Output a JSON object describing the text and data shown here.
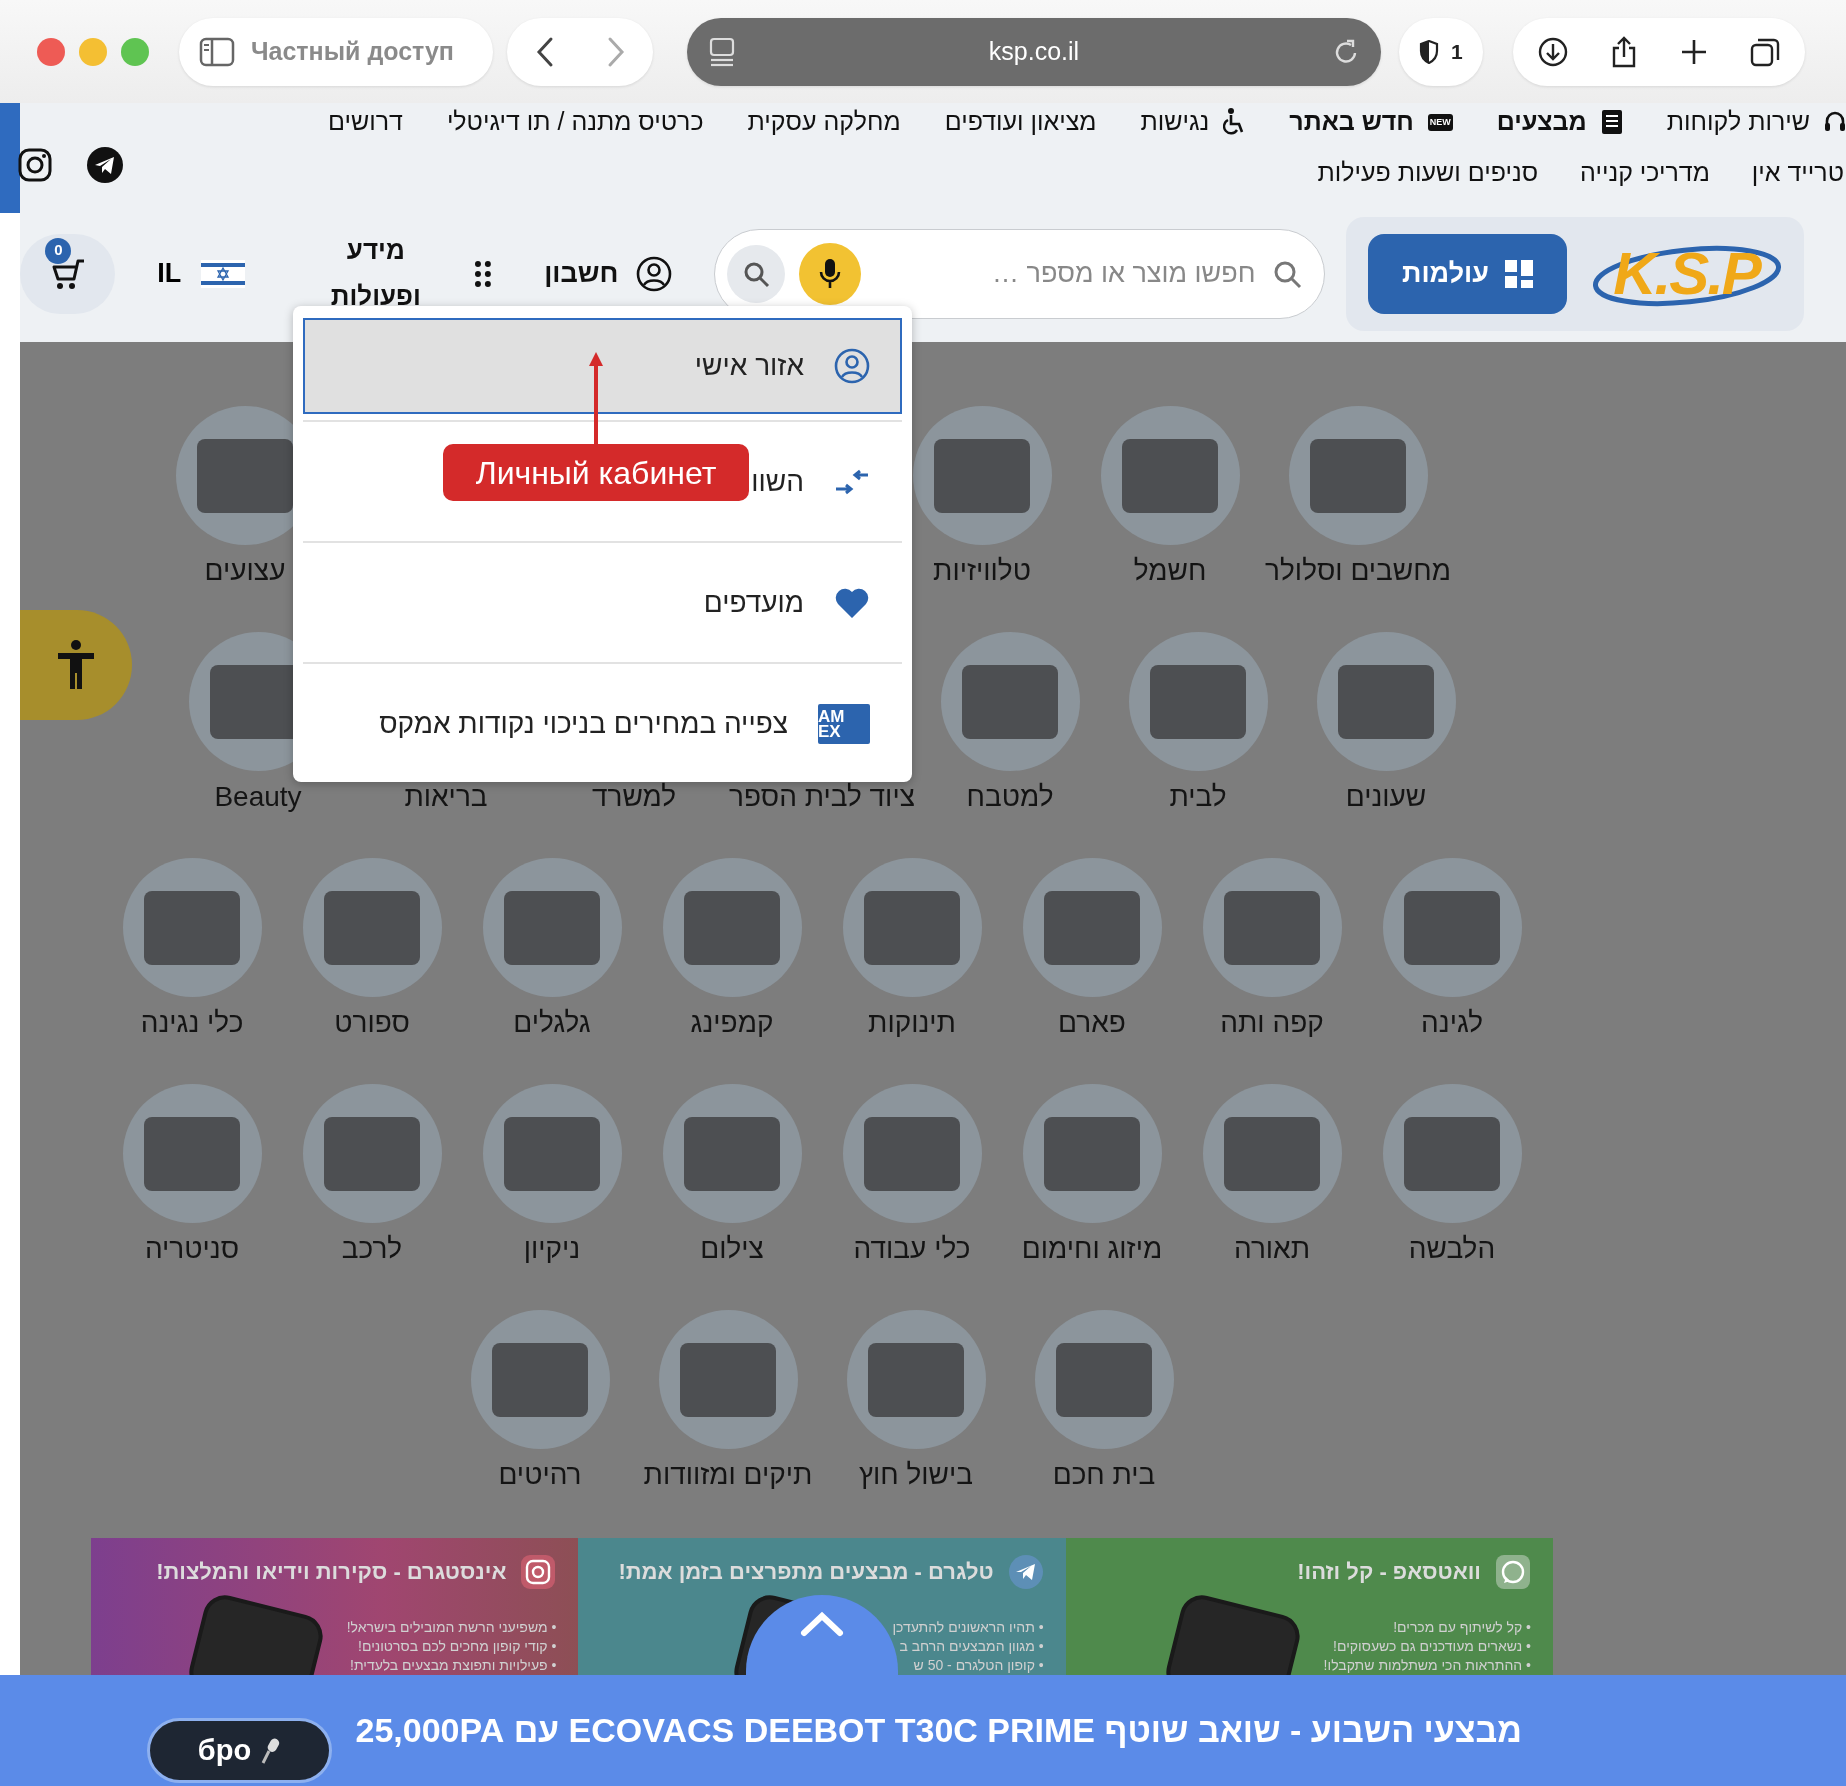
{
  "browser": {
    "private_label": "Частный доступ",
    "address": "ksp.co.il",
    "shield_count": "1"
  },
  "top_links": [
    {
      "label": "שירות לקוחות",
      "kind": "service"
    },
    {
      "label": "מבצעים",
      "kind": "deals"
    },
    {
      "label": "חדש באתר",
      "kind": "new",
      "badge": "NEW"
    },
    {
      "label": "נגישות",
      "kind": "accessibility"
    },
    {
      "label": "מציאון ועודפים",
      "kind": "plain"
    },
    {
      "label": "מחלקה עסקית",
      "kind": "plain"
    },
    {
      "label": "כרטיס מתנה / תו דיגיטלי",
      "kind": "plain"
    },
    {
      "label": "דרושים",
      "kind": "plain"
    }
  ],
  "secondary_links": [
    "טרייד אין",
    "מדריכי קנייה",
    "סניפים ושעות פעילות"
  ],
  "header": {
    "logo": "K.S.P",
    "worlds_button": "עולמות",
    "search_placeholder": "חפשו מוצר או מספר …",
    "account": "חשבון",
    "info": "מידע ופעולות",
    "country": "IL",
    "cart_count": "0"
  },
  "menu": {
    "items": [
      {
        "label": "אזור אישי",
        "kind": "account",
        "selected": true
      },
      {
        "label": "השוו",
        "kind": "compare",
        "selected": false
      },
      {
        "label": "מועדפים",
        "kind": "favorites",
        "selected": false
      },
      {
        "label": "צפייה במחירים בניכוי נקודות אמקס",
        "kind": "amex",
        "selected": false,
        "badge_lines": [
          "AM",
          "EX"
        ]
      }
    ]
  },
  "annotation": {
    "label": "Личный кабинет"
  },
  "category_rows": [
    [
      "מחשבים וסלולר",
      "חשמל",
      "טלוויזיות",
      "עצועים"
    ],
    [
      "שעונים",
      "לבית",
      "למטבח",
      "ציוד לבית הספר",
      "למשרד",
      "בריאות",
      "Beauty"
    ],
    [
      "לגינה",
      "קפה ותה",
      "פארם",
      "תינוקות",
      "קמפינג",
      "גלגלים",
      "ספורט",
      "כלי נגינה"
    ],
    [
      "הלבשה",
      "תאורה",
      "מיזוג וחימום",
      "כלי עבודה",
      "צילום",
      "ניקיון",
      "לרכב",
      "סניטריה"
    ],
    [
      "בית חכם",
      "בישול חוץ",
      "תיקים ומזוודות",
      "רהיטים"
    ]
  ],
  "banners": [
    {
      "kind": "whatsapp",
      "title": "וואטסאפ - קל וזהו!",
      "bullets": [
        "• קל לשיתוף עם מכרים!",
        "• נשארים מעודכנים גם כשעסוקים!",
        "• ההתראות הכי משתלמות שתקבלו!"
      ]
    },
    {
      "kind": "telegram",
      "title": "טלגרם - מבצעים מתפרצים בזמן אמת!",
      "bullets": [
        "• תהיו הראשונים להתעדכן",
        "• מגוון המבצעים הרחב ב",
        "• קופון הטלגרם - 50 ש"
      ]
    },
    {
      "kind": "instagram",
      "title": "אינסטגרם - סקירות וידיאו והמלצות!",
      "bullets": [
        "• משפיעני הרשת המובילים בישראל!",
        "• קודי קופון מחכים לכם בסרטונים!",
        "• פעילויות ותפוצת מבצעים בלעדית!"
      ]
    }
  ],
  "deal_bar": {
    "text": "מבצעי השבוע - שואב שוטף ECOVACS DEEBOT T30C PRIME עם 25,000PA"
  },
  "voice_pill": {
    "label": "бро"
  }
}
